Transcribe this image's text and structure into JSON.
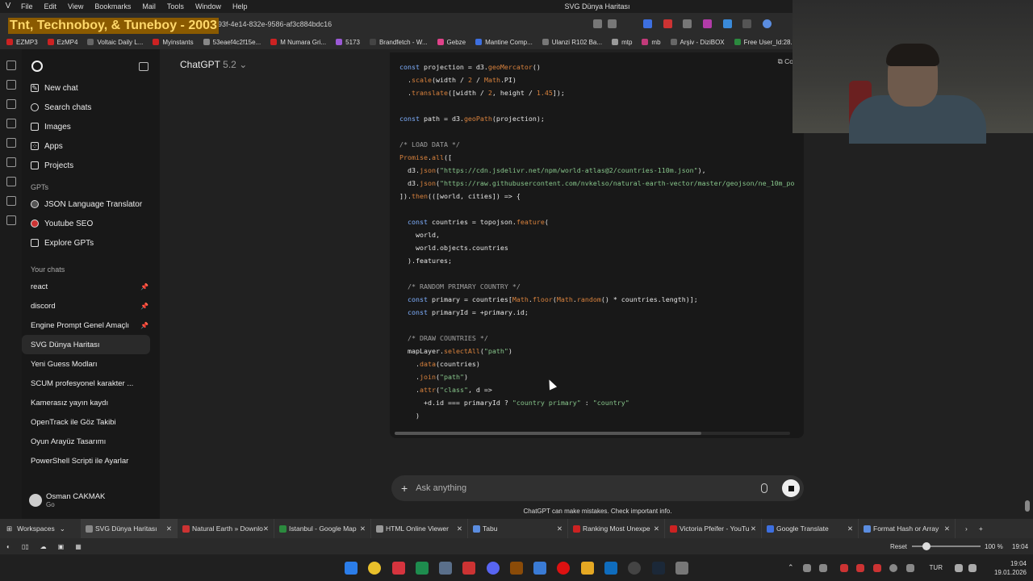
{
  "menubar": {
    "items": [
      "File",
      "Edit",
      "View",
      "Bookmarks",
      "Mail",
      "Tools",
      "Window",
      "Help"
    ],
    "window_title": "SVG Dünya Haritası"
  },
  "address": {
    "overlay_text": "Tnt, Technoboy, & Tuneboy - 2003",
    "url_fragment": "93f-4e14-832e-9586-af3c884bdc16"
  },
  "bookmarks": [
    "EZMP3",
    "EzMP4",
    "Voltaic Daily L...",
    "Myinstants",
    "53eaef4c2f15e...",
    "M Numara Gri...",
    "5173",
    "Brandfetch - W...",
    "Gebze",
    "Mantine Comp...",
    "Ulanzi R102 Ba...",
    "mtp",
    "mb",
    "Arşiv - DiziBOX",
    "Free User_Id:28..."
  ],
  "sidebar": {
    "top_items": [
      {
        "label": "New chat",
        "icon": "new-chat-icon"
      },
      {
        "label": "Search chats",
        "icon": "search-icon"
      },
      {
        "label": "Images",
        "icon": "image-icon"
      },
      {
        "label": "Apps",
        "icon": "apps-icon"
      },
      {
        "label": "Projects",
        "icon": "folder-icon"
      }
    ],
    "gpts_title": "GPTs",
    "gpts": [
      {
        "label": "JSON Language Translator"
      },
      {
        "label": "Youtube SEO"
      },
      {
        "label": "Explore GPTs"
      }
    ],
    "chats_title": "Your chats",
    "chats": [
      {
        "label": "react",
        "pinned": true
      },
      {
        "label": "discord",
        "pinned": true
      },
      {
        "label": "Engine Prompt Genel Amaçlı",
        "pinned": true
      },
      {
        "label": "SVG Dünya Haritası",
        "active": true
      },
      {
        "label": "Yeni Guess Modları"
      },
      {
        "label": "SCUM profesyonel karakter ..."
      },
      {
        "label": "Kamerasız yayın kaydı"
      },
      {
        "label": "OpenTrack ile Göz Takibi"
      },
      {
        "label": "Oyun Arayüz Tasarımı"
      },
      {
        "label": "PowerShell Scripti ile Ayarlar"
      }
    ],
    "user": {
      "name": "Osman CAKMAK",
      "plan": "Go"
    }
  },
  "main": {
    "model_name": "ChatGPT",
    "model_version": "5.2",
    "copy_label": "Copy cod",
    "code_lines": [
      [
        [
          "k",
          "const"
        ],
        [
          "t",
          " projection = d3."
        ],
        [
          "f",
          "geoMercator"
        ],
        [
          "t",
          "()"
        ]
      ],
      [
        [
          "t",
          "  ."
        ],
        [
          "f",
          "scale"
        ],
        [
          "t",
          "(width / "
        ],
        [
          "n",
          "2"
        ],
        [
          "t",
          " / "
        ],
        [
          "f",
          "Math"
        ],
        [
          "t",
          ".PI)"
        ]
      ],
      [
        [
          "t",
          "  ."
        ],
        [
          "f",
          "translate"
        ],
        [
          "t",
          "([width / "
        ],
        [
          "n",
          "2"
        ],
        [
          "t",
          ", height / "
        ],
        [
          "n",
          "1.45"
        ],
        [
          "t",
          "]);"
        ]
      ],
      [
        [
          "t",
          ""
        ]
      ],
      [
        [
          "k",
          "const"
        ],
        [
          "t",
          " path = d3."
        ],
        [
          "f",
          "geoPath"
        ],
        [
          "t",
          "(projection);"
        ]
      ],
      [
        [
          "t",
          ""
        ]
      ],
      [
        [
          "c",
          "/* LOAD DATA */"
        ]
      ],
      [
        [
          "f",
          "Promise"
        ],
        [
          "t",
          "."
        ],
        [
          "f",
          "all"
        ],
        [
          "t",
          "(["
        ]
      ],
      [
        [
          "t",
          "  d3."
        ],
        [
          "f",
          "json"
        ],
        [
          "t",
          "("
        ],
        [
          "s",
          "\"https://cdn.jsdelivr.net/npm/world-atlas@2/countries-110m.json\""
        ],
        [
          "t",
          "),"
        ]
      ],
      [
        [
          "t",
          "  d3."
        ],
        [
          "f",
          "json"
        ],
        [
          "t",
          "("
        ],
        [
          "s",
          "\"https://raw.githubusercontent.com/nvkelso/natural-earth-vector/master/geojson/ne_10m_po"
        ]
      ],
      [
        [
          "t",
          "])."
        ],
        [
          "f",
          "then"
        ],
        [
          "t",
          "(([world, cities]) => {"
        ]
      ],
      [
        [
          "t",
          ""
        ]
      ],
      [
        [
          "t",
          "  "
        ],
        [
          "k",
          "const"
        ],
        [
          "t",
          " countries = topojson."
        ],
        [
          "f",
          "feature"
        ],
        [
          "t",
          "("
        ]
      ],
      [
        [
          "t",
          "    world,"
        ]
      ],
      [
        [
          "t",
          "    world.objects.countries"
        ]
      ],
      [
        [
          "t",
          "  ).features;"
        ]
      ],
      [
        [
          "t",
          ""
        ]
      ],
      [
        [
          "t",
          "  "
        ],
        [
          "c",
          "/* RANDOM PRIMARY COUNTRY */"
        ]
      ],
      [
        [
          "t",
          "  "
        ],
        [
          "k",
          "const"
        ],
        [
          "t",
          " primary = countries["
        ],
        [
          "f",
          "Math"
        ],
        [
          "t",
          "."
        ],
        [
          "f",
          "floor"
        ],
        [
          "t",
          "("
        ],
        [
          "f",
          "Math"
        ],
        [
          "t",
          "."
        ],
        [
          "f",
          "random"
        ],
        [
          "t",
          "() * countries.length)];"
        ]
      ],
      [
        [
          "t",
          "  "
        ],
        [
          "k",
          "const"
        ],
        [
          "t",
          " primaryId = +primary.id;"
        ]
      ],
      [
        [
          "t",
          ""
        ]
      ],
      [
        [
          "t",
          "  "
        ],
        [
          "c",
          "/* DRAW COUNTRIES */"
        ]
      ],
      [
        [
          "t",
          "  mapLayer."
        ],
        [
          "f",
          "selectAll"
        ],
        [
          "t",
          "("
        ],
        [
          "s",
          "\"path\""
        ],
        [
          "t",
          ")"
        ]
      ],
      [
        [
          "t",
          "    ."
        ],
        [
          "f",
          "data"
        ],
        [
          "t",
          "(countries)"
        ]
      ],
      [
        [
          "t",
          "    ."
        ],
        [
          "f",
          "join"
        ],
        [
          "t",
          "("
        ],
        [
          "s",
          "\"path\""
        ],
        [
          "t",
          ")"
        ]
      ],
      [
        [
          "t",
          "    ."
        ],
        [
          "f",
          "attr"
        ],
        [
          "t",
          "("
        ],
        [
          "s",
          "\"class\""
        ],
        [
          "t",
          ", d =>"
        ]
      ],
      [
        [
          "t",
          "      +d.id === primaryId ? "
        ],
        [
          "s",
          "\"country primary\""
        ],
        [
          "t",
          " : "
        ],
        [
          "s",
          "\"country\""
        ]
      ],
      [
        [
          "t",
          "    )"
        ]
      ]
    ],
    "prompt_placeholder": "Ask anything",
    "disclaimer": "ChatGPT can make mistakes. Check important info."
  },
  "tabs": {
    "workspaces_label": "Workspaces",
    "items": [
      {
        "label": "SVG Dünya Haritası",
        "active": true
      },
      {
        "label": "Natural Earth » Downlo"
      },
      {
        "label": "Istanbul - Google Map"
      },
      {
        "label": "HTML Online Viewer"
      },
      {
        "label": "Tabu"
      },
      {
        "label": "Ranking Most Unexpe"
      },
      {
        "label": "Victoria Pfeifer - YouTu"
      },
      {
        "label": "Google Translate"
      },
      {
        "label": "Format Hash or Array"
      }
    ]
  },
  "status": {
    "reset_label": "Reset",
    "zoom": "100 %",
    "time_small": "19:04"
  },
  "taskbar": {
    "lang": "TUR",
    "time": "19:04",
    "date": "19.01.2026"
  }
}
